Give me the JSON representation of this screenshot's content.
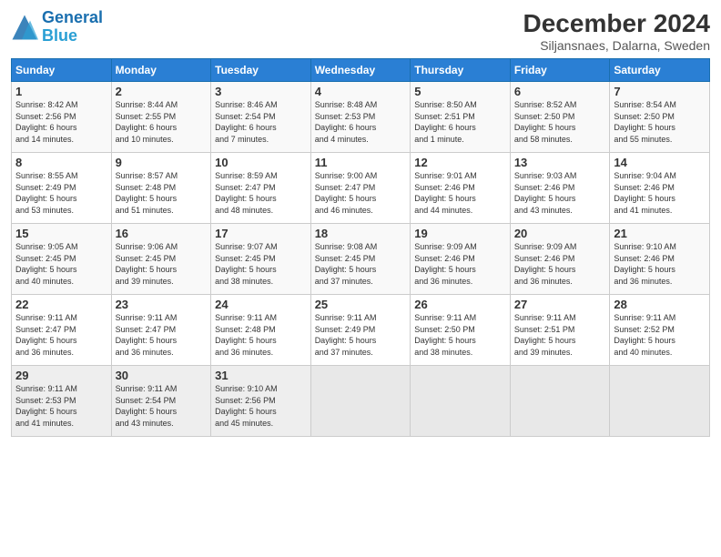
{
  "logo": {
    "line1": "General",
    "line2": "Blue"
  },
  "title": "December 2024",
  "location": "Siljansnaes, Dalarna, Sweden",
  "days_of_week": [
    "Sunday",
    "Monday",
    "Tuesday",
    "Wednesday",
    "Thursday",
    "Friday",
    "Saturday"
  ],
  "weeks": [
    [
      {
        "day": "1",
        "info": "Sunrise: 8:42 AM\nSunset: 2:56 PM\nDaylight: 6 hours\nand 14 minutes."
      },
      {
        "day": "2",
        "info": "Sunrise: 8:44 AM\nSunset: 2:55 PM\nDaylight: 6 hours\nand 10 minutes."
      },
      {
        "day": "3",
        "info": "Sunrise: 8:46 AM\nSunset: 2:54 PM\nDaylight: 6 hours\nand 7 minutes."
      },
      {
        "day": "4",
        "info": "Sunrise: 8:48 AM\nSunset: 2:53 PM\nDaylight: 6 hours\nand 4 minutes."
      },
      {
        "day": "5",
        "info": "Sunrise: 8:50 AM\nSunset: 2:51 PM\nDaylight: 6 hours\nand 1 minute."
      },
      {
        "day": "6",
        "info": "Sunrise: 8:52 AM\nSunset: 2:50 PM\nDaylight: 5 hours\nand 58 minutes."
      },
      {
        "day": "7",
        "info": "Sunrise: 8:54 AM\nSunset: 2:50 PM\nDaylight: 5 hours\nand 55 minutes."
      }
    ],
    [
      {
        "day": "8",
        "info": "Sunrise: 8:55 AM\nSunset: 2:49 PM\nDaylight: 5 hours\nand 53 minutes."
      },
      {
        "day": "9",
        "info": "Sunrise: 8:57 AM\nSunset: 2:48 PM\nDaylight: 5 hours\nand 51 minutes."
      },
      {
        "day": "10",
        "info": "Sunrise: 8:59 AM\nSunset: 2:47 PM\nDaylight: 5 hours\nand 48 minutes."
      },
      {
        "day": "11",
        "info": "Sunrise: 9:00 AM\nSunset: 2:47 PM\nDaylight: 5 hours\nand 46 minutes."
      },
      {
        "day": "12",
        "info": "Sunrise: 9:01 AM\nSunset: 2:46 PM\nDaylight: 5 hours\nand 44 minutes."
      },
      {
        "day": "13",
        "info": "Sunrise: 9:03 AM\nSunset: 2:46 PM\nDaylight: 5 hours\nand 43 minutes."
      },
      {
        "day": "14",
        "info": "Sunrise: 9:04 AM\nSunset: 2:46 PM\nDaylight: 5 hours\nand 41 minutes."
      }
    ],
    [
      {
        "day": "15",
        "info": "Sunrise: 9:05 AM\nSunset: 2:45 PM\nDaylight: 5 hours\nand 40 minutes."
      },
      {
        "day": "16",
        "info": "Sunrise: 9:06 AM\nSunset: 2:45 PM\nDaylight: 5 hours\nand 39 minutes."
      },
      {
        "day": "17",
        "info": "Sunrise: 9:07 AM\nSunset: 2:45 PM\nDaylight: 5 hours\nand 38 minutes."
      },
      {
        "day": "18",
        "info": "Sunrise: 9:08 AM\nSunset: 2:45 PM\nDaylight: 5 hours\nand 37 minutes."
      },
      {
        "day": "19",
        "info": "Sunrise: 9:09 AM\nSunset: 2:46 PM\nDaylight: 5 hours\nand 36 minutes."
      },
      {
        "day": "20",
        "info": "Sunrise: 9:09 AM\nSunset: 2:46 PM\nDaylight: 5 hours\nand 36 minutes."
      },
      {
        "day": "21",
        "info": "Sunrise: 9:10 AM\nSunset: 2:46 PM\nDaylight: 5 hours\nand 36 minutes."
      }
    ],
    [
      {
        "day": "22",
        "info": "Sunrise: 9:11 AM\nSunset: 2:47 PM\nDaylight: 5 hours\nand 36 minutes."
      },
      {
        "day": "23",
        "info": "Sunrise: 9:11 AM\nSunset: 2:47 PM\nDaylight: 5 hours\nand 36 minutes."
      },
      {
        "day": "24",
        "info": "Sunrise: 9:11 AM\nSunset: 2:48 PM\nDaylight: 5 hours\nand 36 minutes."
      },
      {
        "day": "25",
        "info": "Sunrise: 9:11 AM\nSunset: 2:49 PM\nDaylight: 5 hours\nand 37 minutes."
      },
      {
        "day": "26",
        "info": "Sunrise: 9:11 AM\nSunset: 2:50 PM\nDaylight: 5 hours\nand 38 minutes."
      },
      {
        "day": "27",
        "info": "Sunrise: 9:11 AM\nSunset: 2:51 PM\nDaylight: 5 hours\nand 39 minutes."
      },
      {
        "day": "28",
        "info": "Sunrise: 9:11 AM\nSunset: 2:52 PM\nDaylight: 5 hours\nand 40 minutes."
      }
    ],
    [
      {
        "day": "29",
        "info": "Sunrise: 9:11 AM\nSunset: 2:53 PM\nDaylight: 5 hours\nand 41 minutes."
      },
      {
        "day": "30",
        "info": "Sunrise: 9:11 AM\nSunset: 2:54 PM\nDaylight: 5 hours\nand 43 minutes."
      },
      {
        "day": "31",
        "info": "Sunrise: 9:10 AM\nSunset: 2:56 PM\nDaylight: 5 hours\nand 45 minutes."
      },
      {
        "day": "",
        "info": ""
      },
      {
        "day": "",
        "info": ""
      },
      {
        "day": "",
        "info": ""
      },
      {
        "day": "",
        "info": ""
      }
    ]
  ]
}
